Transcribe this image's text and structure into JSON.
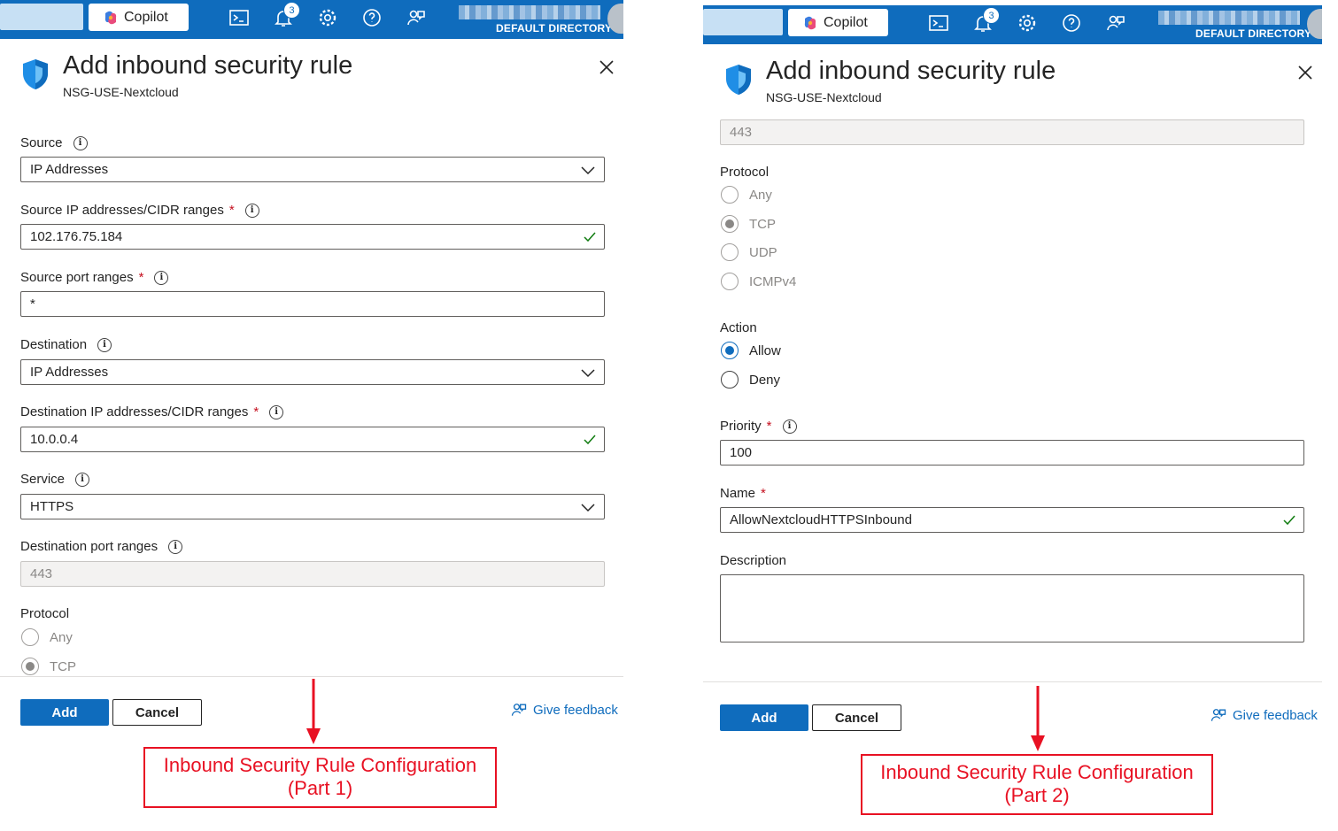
{
  "topbar": {
    "copilot_label": "Copilot",
    "notification_count": "3",
    "directory_label": "DEFAULT DIRECTORY"
  },
  "panel": {
    "title": "Add inbound security rule",
    "subtitle": "NSG-USE-Nextcloud"
  },
  "part1": {
    "source_label": "Source",
    "source_value": "IP Addresses",
    "source_ip_label": "Source IP addresses/CIDR ranges",
    "source_ip_value": "102.176.75.184",
    "source_port_label": "Source port ranges",
    "source_port_value": "*",
    "destination_label": "Destination",
    "destination_value": "IP Addresses",
    "dest_ip_label": "Destination IP addresses/CIDR ranges",
    "dest_ip_value": "10.0.0.4",
    "service_label": "Service",
    "service_value": "HTTPS",
    "dest_port_label": "Destination port ranges",
    "dest_port_value": "443",
    "protocol_label": "Protocol",
    "protocol_options": [
      "Any",
      "TCP"
    ]
  },
  "part2": {
    "dest_port_value": "443",
    "protocol_label": "Protocol",
    "protocol_options": [
      "Any",
      "TCP",
      "UDP",
      "ICMPv4"
    ],
    "protocol_selected": "TCP",
    "action_label": "Action",
    "action_options": [
      "Allow",
      "Deny"
    ],
    "action_selected": "Allow",
    "priority_label": "Priority",
    "priority_value": "100",
    "name_label": "Name",
    "name_value": "AllowNextcloudHTTPSInbound",
    "description_label": "Description",
    "description_value": ""
  },
  "footer": {
    "add_label": "Add",
    "cancel_label": "Cancel",
    "feedback_label": "Give feedback"
  },
  "annotations": {
    "part1_line1": "Inbound Security Rule Configuration",
    "part1_line2": "(Part 1)",
    "part2_line1": "Inbound Security Rule Configuration",
    "part2_line2": "(Part 2)",
    "color": "#e81123"
  },
  "colors": {
    "azure_blue": "#0f6cbd",
    "required_red": "#c50f1f"
  }
}
